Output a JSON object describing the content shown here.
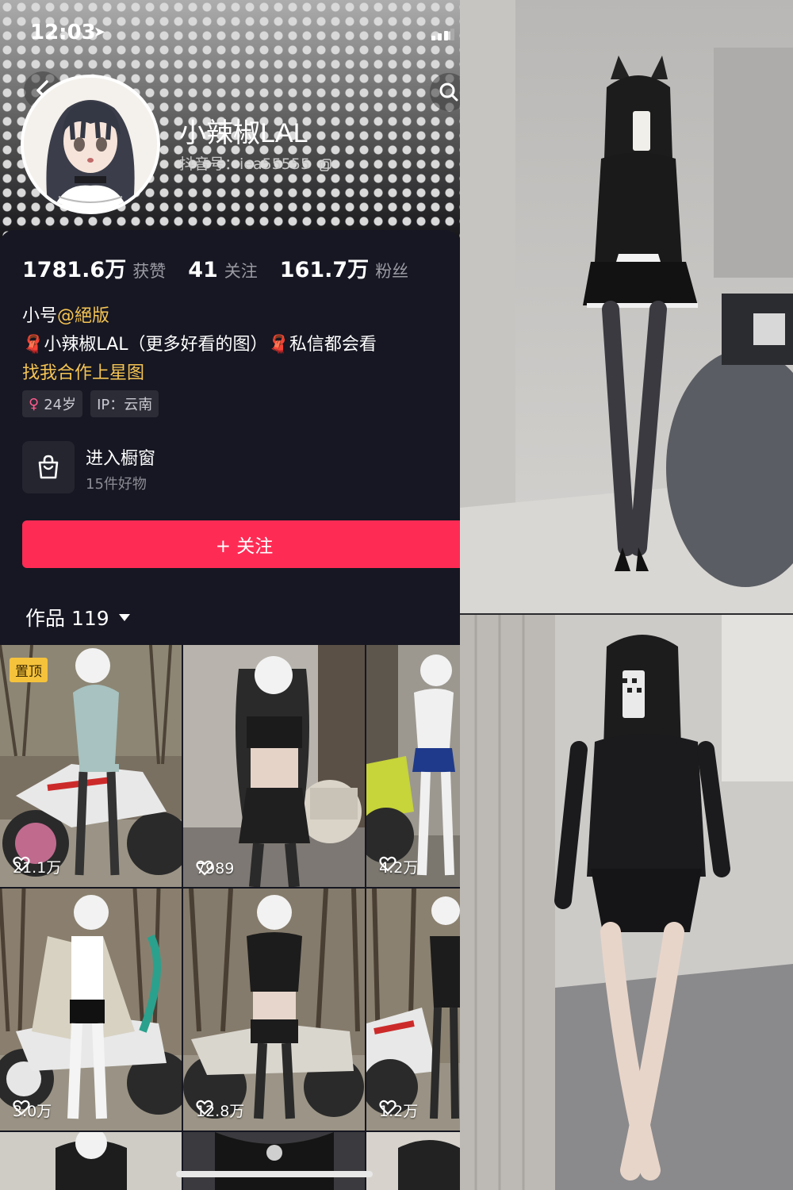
{
  "status_bar": {
    "time": "12:03"
  },
  "profile": {
    "nickname": "小辣椒LAL",
    "douyin_id": "抖音号：iea55555"
  },
  "stats": [
    {
      "value": "1781.6万",
      "label": "获赞"
    },
    {
      "value": "41",
      "label": "关注"
    },
    {
      "value": "161.7万",
      "label": "粉丝"
    }
  ],
  "bio": {
    "line1_prefix": "小号",
    "line1_mention": "@絕版",
    "line2": "🧣小辣椒LAL（更多好看的图）🧣私信都会看",
    "line3": "找我合作上星图"
  },
  "tags": {
    "age": "24岁",
    "ip": "IP：云南"
  },
  "shop": {
    "title": "进入橱窗",
    "subtitle": "15件好物"
  },
  "follow_button": "+ 关注",
  "works_tab": "作品 119",
  "pinned_label": "置顶",
  "videos": [
    {
      "likes": "21.1万"
    },
    {
      "likes": "7989"
    },
    {
      "likes": "4.2万"
    },
    {
      "likes": "3.0万"
    },
    {
      "likes": "12.8万"
    },
    {
      "likes": "1.2万"
    }
  ],
  "icons": {
    "back": "back-arrow-icon",
    "search": "search-icon",
    "copy": "copy-icon",
    "shop": "shopping-bag-icon",
    "heart": "heart-icon",
    "navigation": "location-arrow-icon",
    "signal": "signal-icon"
  },
  "colors": {
    "follow": "#fe2c55",
    "mention": "#f5c453",
    "background": "#161722"
  }
}
